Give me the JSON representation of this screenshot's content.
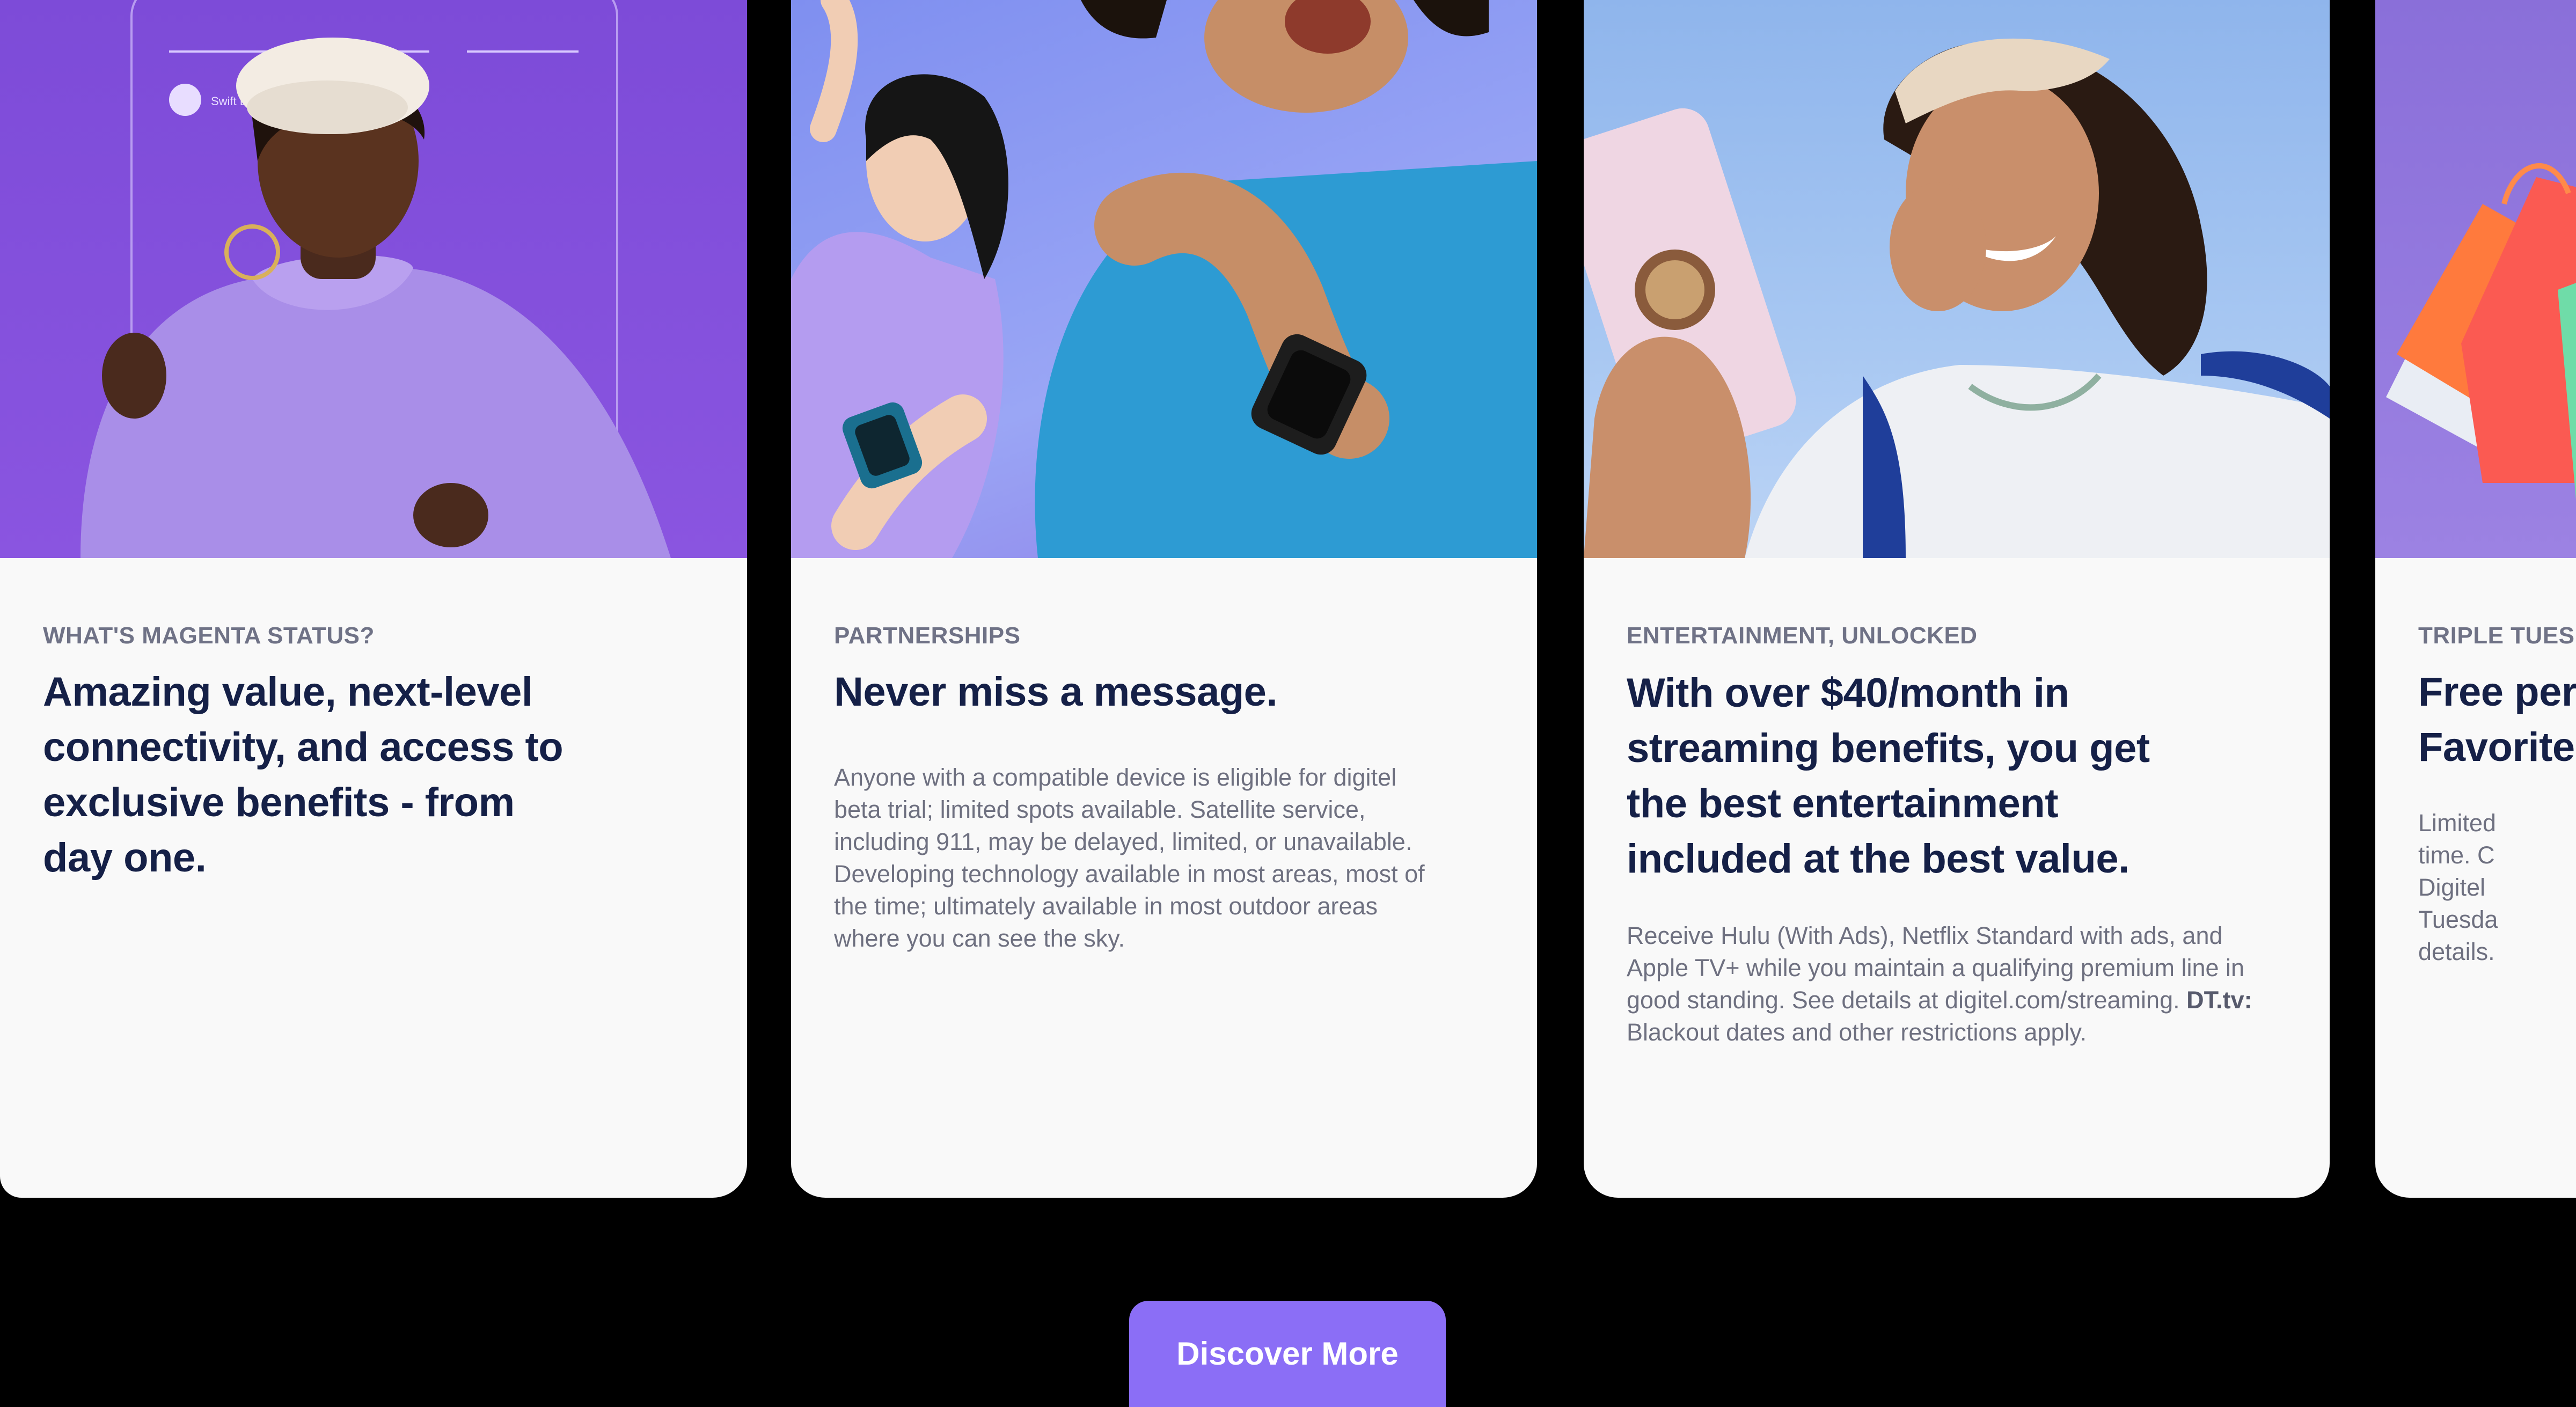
{
  "cards": [
    {
      "eyebrow": "WHAT'S MAGENTA STATUS?",
      "headline": "Amazing value, next-level connectivity, and access to exclusive benefits - from day one.",
      "description": "",
      "image_alt": "Woman in purple sweater and white beret smiling with phone frame overlay",
      "phone_overlay_label": "Swift Bank"
    },
    {
      "eyebrow": "PARTNERSHIPS",
      "headline": "Never miss a message.",
      "description": "Anyone with a compatible device is eligible for digitel beta trial; limited spots available. Satellite service, including 911, may be delayed, limited, or unavailable. Developing technology available in most areas, most of the time; ultimately available in most outdoor areas where you can see the sky.",
      "image_alt": "Two people dancing wearing smartwatches"
    },
    {
      "eyebrow": "ENTERTAINMENT, UNLOCKED",
      "headline": "With over $40/month in streaming benefits, you get the best entertainment included at the best value.",
      "description_main": "Receive Hulu (With Ads), Netflix Standard with ads, and Apple TV+ while you maintain a qualifying premium line in good standing. See details at digitel.com/streaming.",
      "description_bold": "DT.tv:",
      "description_tail": "Blackout dates and other restrictions apply.",
      "image_alt": "Woman laughing holding a phone"
    },
    {
      "eyebrow": "TRIPLE TUESD",
      "headline_line1": "Free per",
      "headline_line2": "Favorite",
      "description": "Limited time. C Digitel Tuesda details.",
      "image_alt": "Shopping bags"
    }
  ],
  "cta": {
    "label": "Discover More"
  },
  "colors": {
    "button": "#8b6ef6",
    "headline": "#152047",
    "card_bg": "#f9f9f9",
    "card1_bg": "#7d4bd8"
  }
}
